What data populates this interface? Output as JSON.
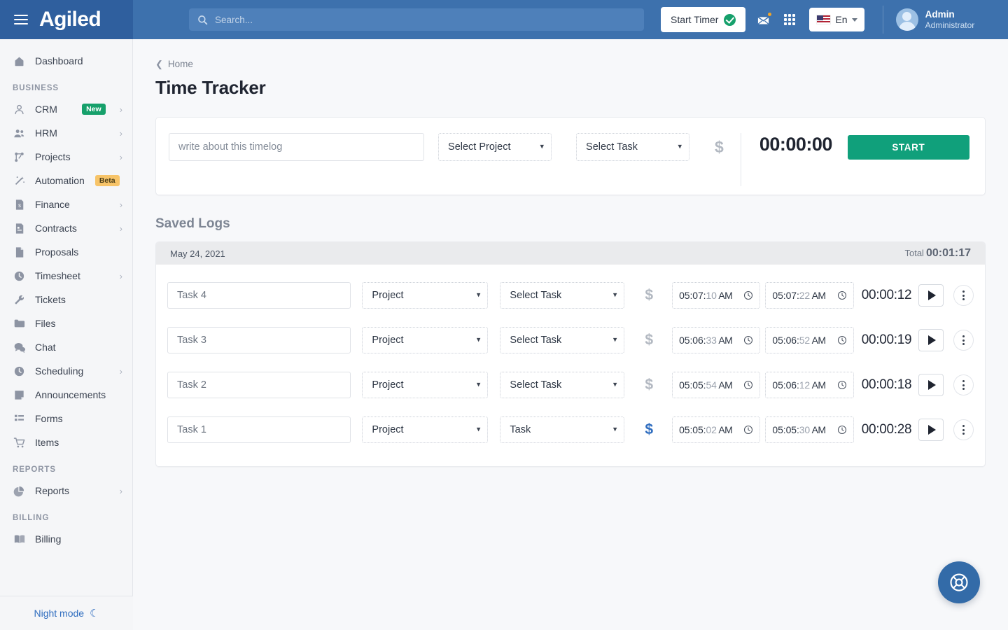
{
  "header": {
    "logo": "Agiled",
    "menu_icon": "hamburger-icon",
    "search": {
      "placeholder": "Search...",
      "value": ""
    },
    "start_timer_label": "Start Timer",
    "mail_icon": "envelope-icon",
    "apps_icon": "grid-apps-icon",
    "language": "En",
    "user": {
      "name": "Admin",
      "role": "Administrator"
    }
  },
  "sidebar": {
    "top_items": [
      {
        "label": "Dashboard",
        "icon": "home-icon",
        "chevron": false
      }
    ],
    "sections": [
      {
        "title": "BUSINESS",
        "items": [
          {
            "label": "CRM",
            "icon": "user-icon",
            "badge": "New",
            "badge_type": "new",
            "chevron": true
          },
          {
            "label": "HRM",
            "icon": "users-icon",
            "chevron": true
          },
          {
            "label": "Projects",
            "icon": "sitemap-icon",
            "chevron": true
          },
          {
            "label": "Automation",
            "icon": "magic-wand-icon",
            "badge": "Beta",
            "badge_type": "beta",
            "chevron": true
          },
          {
            "label": "Finance",
            "icon": "invoice-icon",
            "chevron": true
          },
          {
            "label": "Contracts",
            "icon": "contract-icon",
            "chevron": true
          },
          {
            "label": "Proposals",
            "icon": "document-icon",
            "chevron": false
          },
          {
            "label": "Timesheet",
            "icon": "clock-icon",
            "chevron": true
          },
          {
            "label": "Tickets",
            "icon": "wrench-icon",
            "chevron": false
          },
          {
            "label": "Files",
            "icon": "folder-icon",
            "chevron": false
          },
          {
            "label": "Chat",
            "icon": "chat-bubbles-icon",
            "chevron": false
          },
          {
            "label": "Scheduling",
            "icon": "clock-icon",
            "chevron": true
          },
          {
            "label": "Announcements",
            "icon": "note-icon",
            "chevron": false
          },
          {
            "label": "Forms",
            "icon": "list-icon",
            "chevron": false
          },
          {
            "label": "Items",
            "icon": "cart-icon",
            "chevron": false
          }
        ]
      },
      {
        "title": "REPORTS",
        "items": [
          {
            "label": "Reports",
            "icon": "pie-chart-icon",
            "chevron": true
          }
        ]
      },
      {
        "title": "BILLING",
        "items": [
          {
            "label": "Billing",
            "icon": "book-icon",
            "chevron": false
          }
        ]
      }
    ],
    "footer": {
      "label": "Night mode",
      "icon": "moon-icon"
    }
  },
  "main": {
    "breadcrumb": "Home",
    "page_title": "Time Tracker",
    "timer_card": {
      "note_placeholder": "write about this timelog",
      "note_value": "",
      "project_select": "Select Project",
      "task_select": "Select Task",
      "billable_icon": "dollar-icon",
      "timer_value": "00:00:00",
      "start_button": "START"
    },
    "saved_logs": {
      "title": "Saved Logs",
      "date": "May 24, 2021",
      "total_label": "Total",
      "total_value": "00:01:17",
      "rows": [
        {
          "task": "Task 4",
          "project": "Project",
          "subtask": "Select Task",
          "billable": false,
          "start_time": "05:07:10 AM",
          "start_h": "05:07:",
          "start_s": "10",
          "start_mer": " AM",
          "end_time": "05:07:22 AM",
          "end_h": "05:07:",
          "end_s": "22",
          "end_mer": " AM",
          "duration": "00:00:12"
        },
        {
          "task": "Task 3",
          "project": "Project",
          "subtask": "Select Task",
          "billable": false,
          "start_time": "05:06:33 AM",
          "start_h": "05:06:",
          "start_s": "33",
          "start_mer": " AM",
          "end_time": "05:06:52 AM",
          "end_h": "05:06:",
          "end_s": "52",
          "end_mer": " AM",
          "duration": "00:00:19"
        },
        {
          "task": "Task 2",
          "project": "Project",
          "subtask": "Select Task",
          "billable": false,
          "start_time": "05:05:54 AM",
          "start_h": "05:05:",
          "start_s": "54",
          "start_mer": " AM",
          "end_time": "05:06:12 AM",
          "end_h": "05:06:",
          "end_s": "12",
          "end_mer": " AM",
          "duration": "00:00:18"
        },
        {
          "task": "Task 1",
          "project": "Project",
          "subtask": "Task",
          "billable": true,
          "start_time": "05:05:02 AM",
          "start_h": "05:05:",
          "start_s": "02",
          "start_mer": " AM",
          "end_time": "05:05:30 AM",
          "end_h": "05:05:",
          "end_s": "30",
          "end_mer": " AM",
          "duration": "00:00:28"
        }
      ]
    },
    "support_fab": "lifebuoy-icon"
  },
  "colors": {
    "header_blue": "#3d71ad",
    "logo_blue": "#2f5f9e",
    "accent_green": "#10a07b",
    "badge_new": "#16a06b",
    "badge_beta": "#f7c469",
    "billable_blue": "#2f6dbf",
    "fab_blue": "#336ba8"
  }
}
